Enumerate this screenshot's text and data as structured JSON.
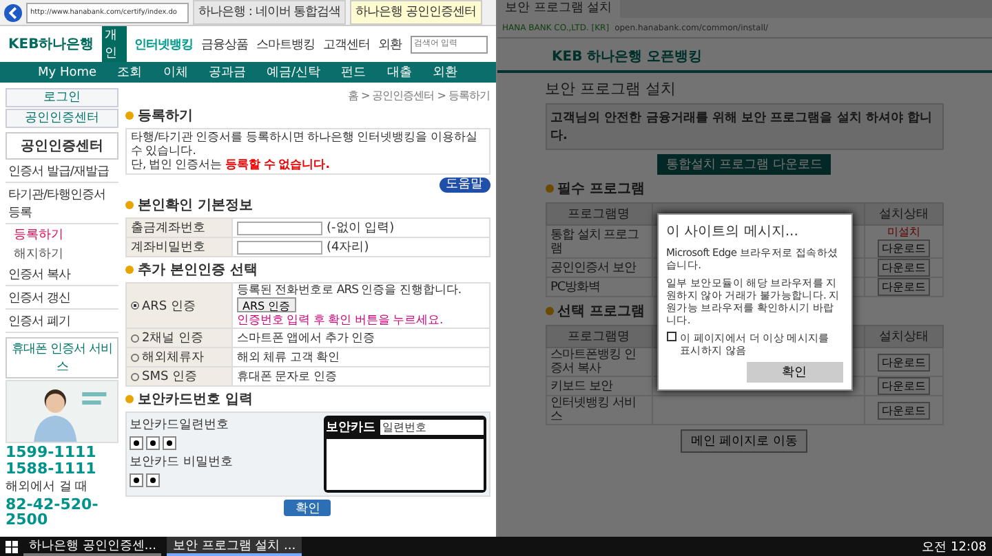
{
  "left_window": {
    "address": "http://www.hanabank.com/certify/index.do",
    "tabs": [
      {
        "label": "하나은행 : 네이버 통합검색",
        "selected": false
      },
      {
        "label": "하나은행 공인인증센터",
        "selected": true
      }
    ],
    "logo": "KEB하나은행",
    "logo_badge": "개인",
    "top_nav": [
      "인터넷뱅킹",
      "금융상품",
      "스마트뱅킹",
      "고객센터",
      "외환"
    ],
    "search_placeholder": "검색어 입력",
    "main_nav": [
      "My Home",
      "조회",
      "이체",
      "공과금",
      "예금/신탁",
      "펀드",
      "대출",
      "외환"
    ],
    "sidebar": {
      "buttons": [
        "로그인",
        "공인인증센터"
      ],
      "title": "공인인증센터",
      "items": [
        {
          "label": "인증서 발급/재발급",
          "selected": false
        },
        {
          "label": "타기관/타행인증서 등록",
          "selected": false,
          "children": [
            {
              "label": "등록하기",
              "selected": true
            },
            {
              "label": "해지하기",
              "selected": false
            }
          ]
        },
        {
          "label": "인증서 복사",
          "selected": false
        },
        {
          "label": "인증서 갱신",
          "selected": false
        },
        {
          "label": "인증서 폐기",
          "selected": false
        }
      ],
      "service_banner": "휴대폰 인증서 서비스",
      "phones": [
        "1599-1111",
        "1588-1111"
      ],
      "abroad_title": "해외에서 걸 때",
      "abroad_phone": "82-42-520-2500"
    },
    "main": {
      "breadcrumb": "홈 > 공인인증센터 > 등록하기",
      "title": "등록하기",
      "notices": [
        {
          "text": "타행/타기관 인증서를 등록하시면 하나은행 인터넷뱅킹을 이용하실 수 있습니다."
        },
        {
          "text": "단, 법인 인증서는 ",
          "emphasis": "등록할 수 없습니다."
        }
      ],
      "help_button": "도움말",
      "basic_info": {
        "title": "본인확인 기본정보",
        "fields": [
          {
            "label": "출금계좌번호",
            "hint": "(-없이 입력)"
          },
          {
            "label": "계좌비밀번호",
            "hint": "(4자리)"
          }
        ]
      },
      "auth": {
        "title": "추가 본인인증 선택",
        "options": [
          {
            "label": "ARS 인증",
            "selected": true,
            "description": "등록된 전화번호로 ARS 인증을 진행합니다."
          },
          {
            "label": "2채널 인증",
            "selected": false,
            "description": "스마트폰 앱에서 추가 인증"
          },
          {
            "label": "해외체류자",
            "selected": false,
            "description": "해외 체류 고객 확인"
          },
          {
            "label": "SMS 인증",
            "selected": false,
            "description": "휴대폰 문자로 인증"
          }
        ],
        "ars_button": "ARS 인증",
        "warning": "인증번호 입력 후 확인 버튼을 누르세요."
      },
      "card": {
        "title": "보안카드번호 입력",
        "serial_label": "보안카드일련번호",
        "pin_label": "보안카드 비밀번호",
        "card_title": "보안카드",
        "card_serial": "일련번호"
      },
      "confirm": "확인"
    }
  },
  "right_window": {
    "tab": "보안 프로그램 설치",
    "site_id": "HANA BANK CO.,LTD. [KR]",
    "address": "open.hanabank.com/common/install/",
    "logo": "KEB 하나은행 오픈뱅킹",
    "title": "보안 프로그램 설치",
    "notice": "고객님의 안전한 금융거래를 위해 보안 프로그램을 설치 하셔야 합니다.",
    "download_all": "통합설치 프로그램 다운로드",
    "required": {
      "title": "필수 프로그램",
      "columns": [
        "프로그램명",
        "설치상태"
      ],
      "rows": [
        {
          "name": "통합 설치 프로그램",
          "status": "미설치",
          "action": "다운로드"
        },
        {
          "name": "공인인증서 보안",
          "action": "다운로드"
        },
        {
          "name": "PC방화벽",
          "action": "다운로드"
        }
      ]
    },
    "optional": {
      "title": "선택 프로그램",
      "columns": [
        "프로그램명",
        "설치상태"
      ],
      "rows": [
        {
          "name": "스마트폰뱅킹 인증서 복사",
          "action": "다운로드"
        },
        {
          "name": "키보드 보안",
          "action": "다운로드"
        },
        {
          "name": "인터넷뱅킹 서비스",
          "action": "다운로드"
        }
      ]
    },
    "main_button": "메인 페이지로 이동",
    "dialog": {
      "title": "이 사이트의 메시지...",
      "line1": "Microsoft Edge 브라우저로 접속하셨습니다.",
      "body": "일부 보안모듈이 해당 브라우저를 지원하지 않아 거래가 불가능합니다. 지원가능 브라우저를 확인하시기 바랍니다.",
      "checkbox": {
        "label": "이 페이지에서 더 이상 메시지를 표시하지 않음",
        "checked": false
      },
      "ok": "확인"
    }
  },
  "taskbar": {
    "tasks": [
      {
        "label": "하나은행 공인인증센...",
        "selected": false
      },
      {
        "label": "보안 프로그램 설치 ...",
        "selected": true
      }
    ],
    "clock": "오전 12:08"
  }
}
